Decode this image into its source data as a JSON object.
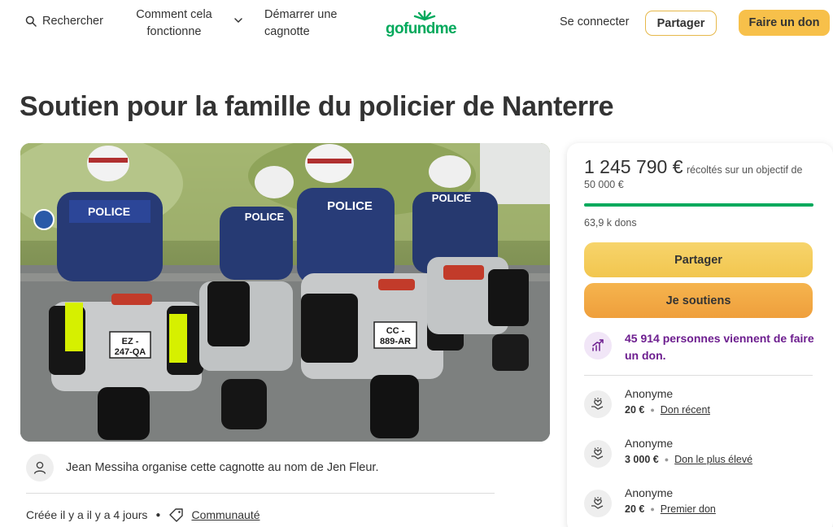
{
  "nav": {
    "search_label": "Rechercher",
    "how_it_works": "Comment cela fonctionne",
    "start_campaign": "Démarrer une cagnotte",
    "logo_text": "gofundme",
    "login": "Se connecter",
    "share": "Partager",
    "donate": "Faire un don"
  },
  "campaign": {
    "title": "Soutien pour la famille du policier de Nanterre",
    "photo_alt": "Policiers à moto",
    "plate_left": "EZ-247-QA",
    "plate_right": "CC-889-AR",
    "organizer_text": "Jean Messiha organise cette cagnotte au nom de Jen Fleur.",
    "created": "Créée il y a il y a 4 jours",
    "category": "Communauté"
  },
  "sidebar": {
    "raised_amount": "1 245 790 €",
    "raised_goal": "récoltés sur un objectif de 50 000 €",
    "progress_fraction": 1.0,
    "donations_count": "63,9 k dons",
    "share_button": "Partager",
    "donate_button": "Je soutiens",
    "trending_text": "45 914 personnes viennent de faire un don.",
    "donors": [
      {
        "name": "Anonyme",
        "amount": "20 €",
        "tag": "Don récent"
      },
      {
        "name": "Anonyme",
        "amount": "3 000 €",
        "tag": "Don le plus élevé"
      },
      {
        "name": "Anonyme",
        "amount": "20 €",
        "tag": "Premier don"
      }
    ]
  },
  "colors": {
    "brand_green": "#02a95c",
    "accent_yellow": "#f7c04a",
    "accent_orange": "#ef9f3c",
    "trend_purple": "#6d1e8f"
  }
}
